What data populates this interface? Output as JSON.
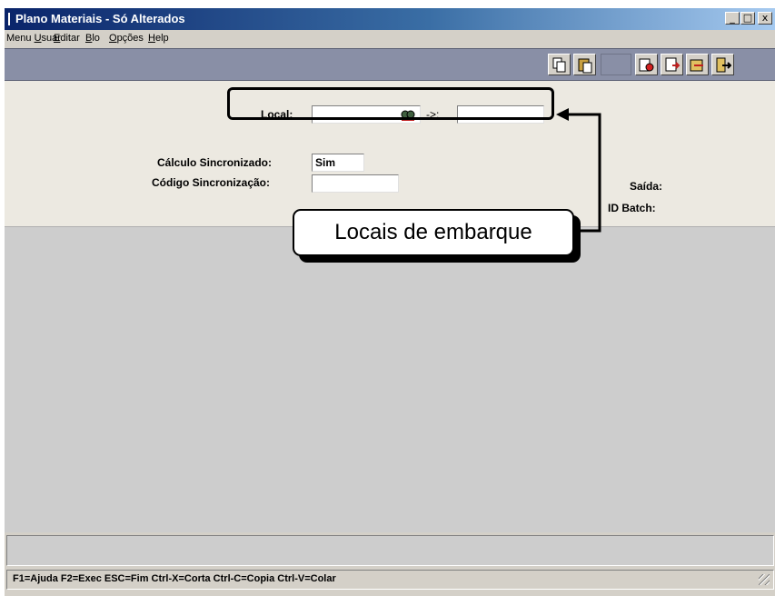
{
  "window": {
    "title": "Plano Materiais - Só Alterados",
    "minimize": "_",
    "maximize": "□",
    "close": "x"
  },
  "menu": [
    {
      "prefix": "Menu ",
      "underline": "U",
      "suffix": "suar"
    },
    {
      "prefix": "",
      "underline": "E",
      "suffix": "ditar"
    },
    {
      "prefix": "",
      "underline": "B",
      "suffix": "lo"
    },
    {
      "prefix": "",
      "underline": "O",
      "suffix": "pções"
    },
    {
      "prefix": "",
      "underline": "H",
      "suffix": "elp"
    }
  ],
  "toolbar": {
    "icons": [
      "copy-icon",
      "paste-icon",
      "blank",
      "binoculars-icon",
      "document-arrow-icon",
      "export-icon",
      "exit-door-icon"
    ]
  },
  "form": {
    "local_label": "Local:",
    "local_value": "",
    "arrow_sep": "->:",
    "local_to_value": "",
    "calc_label": "Cálculo Sincronizado:",
    "calc_value": "Sim",
    "code_label": "Código Sincronização:",
    "code_value": "",
    "saida_label": "Saída:",
    "batch_label": "ID Batch:"
  },
  "callout": {
    "text": "Locais de embarque"
  },
  "statusbar": {
    "text": "F1=Ajuda F2=Exec ESC=Fim Ctrl-X=Corta Ctrl-C=Copia Ctrl-V=Colar"
  },
  "colors": {
    "titlebar_start": "#0a246a",
    "titlebar_end": "#a6caf0",
    "toolbar_bg": "#898fa6",
    "form_bg": "#ece9e1",
    "workspace_bg": "#cdcdcd"
  }
}
